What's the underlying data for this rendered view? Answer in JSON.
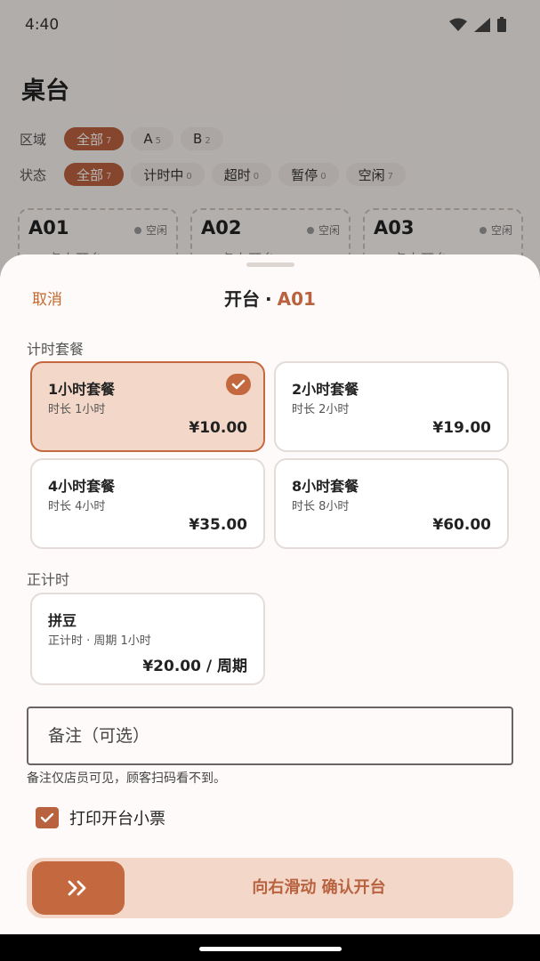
{
  "status": {
    "time": "4:40"
  },
  "page": {
    "title": "桌台"
  },
  "filters": {
    "area": {
      "label": "区域",
      "chips": [
        {
          "label": "全部",
          "count": "7",
          "active": true
        },
        {
          "label": "A",
          "count": "5",
          "active": false
        },
        {
          "label": "B",
          "count": "2",
          "active": false
        }
      ]
    },
    "state": {
      "label": "状态",
      "chips": [
        {
          "label": "全部",
          "count": "7",
          "active": true
        },
        {
          "label": "计时中",
          "count": "0",
          "active": false
        },
        {
          "label": "超时",
          "count": "0",
          "active": false
        },
        {
          "label": "暂停",
          "count": "0",
          "active": false
        },
        {
          "label": "空闲",
          "count": "7",
          "active": false
        }
      ]
    }
  },
  "tables": [
    {
      "name": "A01",
      "status": "空闲",
      "hint": "+ 点击开台"
    },
    {
      "name": "A02",
      "status": "空闲",
      "hint": "+ 点击开台"
    },
    {
      "name": "A03",
      "status": "空闲",
      "hint": "+ 点击开台"
    }
  ],
  "sheet": {
    "cancel": "取消",
    "title": "开台",
    "separator": "·",
    "table_code": "A01",
    "timed_section": "计时套餐",
    "packages": [
      {
        "name": "1小时套餐",
        "desc": "时长 1小时",
        "price": "¥10.00",
        "selected": true
      },
      {
        "name": "2小时套餐",
        "desc": "时长 2小时",
        "price": "¥19.00",
        "selected": false
      },
      {
        "name": "4小时套餐",
        "desc": "时长 4小时",
        "price": "¥35.00",
        "selected": false
      },
      {
        "name": "8小时套餐",
        "desc": "时长 8小时",
        "price": "¥60.00",
        "selected": false
      }
    ],
    "forward_section": "正计时",
    "forward_packages": [
      {
        "name": "拼豆",
        "desc": "正计时 · 周期 1小时",
        "price": "¥20.00 / 周期"
      }
    ],
    "note": {
      "placeholder": "备注（可选）",
      "value": "",
      "help": "备注仅店员可见，顾客扫码看不到。"
    },
    "print": {
      "label": "打印开台小票",
      "checked": true
    },
    "slider": {
      "text": "向右滑动 确认开台"
    }
  },
  "colors": {
    "accent": "#b9623f",
    "selected_bg": "#f3d8c9",
    "text_accent": "#c4692f"
  },
  "icons": {
    "wifi": "wifi-icon",
    "signal": "signal-icon",
    "battery": "battery-icon",
    "check": "check-icon",
    "double_chevron": "double-chevron-right-icon"
  }
}
